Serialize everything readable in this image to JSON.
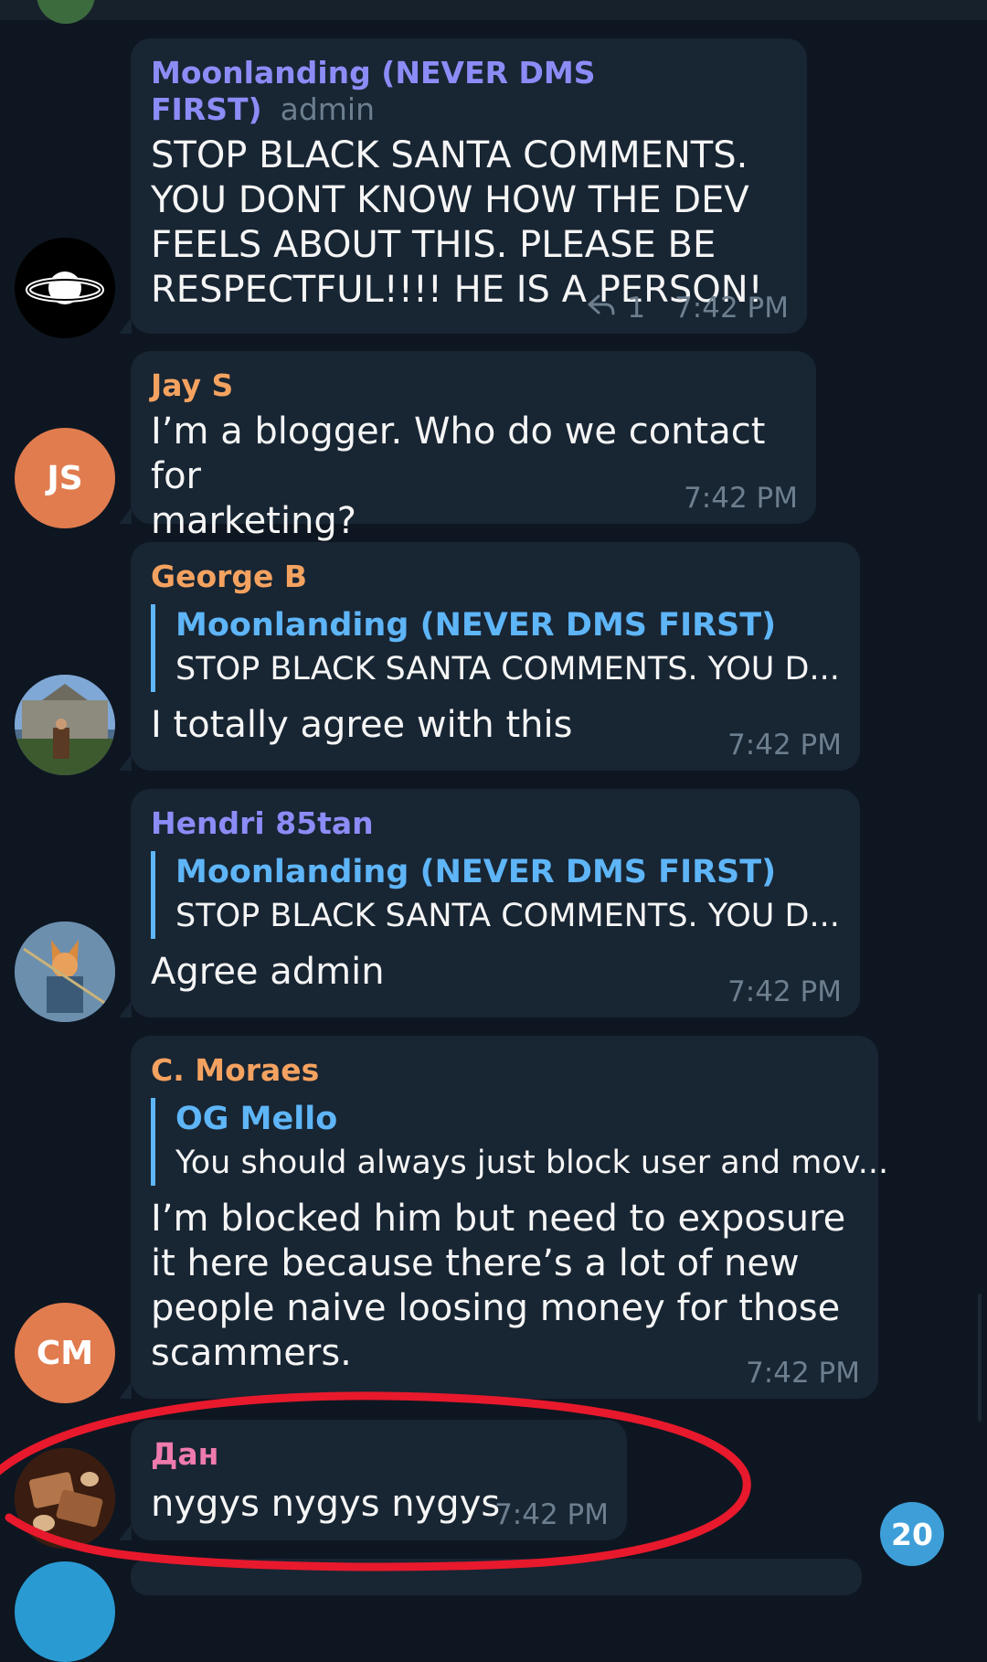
{
  "colors": {
    "background": "#0e1621",
    "bubble": "#182533",
    "meta": "#6d7f8f",
    "reply_accent": "#5eb5f7",
    "annotation": "#e8192c",
    "unread_badge": "#3e9fd8"
  },
  "messages": [
    {
      "sender": "Moonlanding (NEVER DMS FIRST)",
      "sender_color": "#8c8cf7",
      "role": "admin",
      "avatar": "saturn-logo",
      "text": "STOP BLACK SANTA COMMENTS.\nYOU DONT KNOW HOW THE DEV\nFEELS ABOUT THIS. PLEASE BE\nRESPECTFUL!!!! HE IS A PERSON!",
      "replies_count": "1",
      "time": "7:42 PM"
    },
    {
      "sender": "Jay S",
      "sender_color": "#f4a260",
      "avatar_initials": "JS",
      "text": "I’m a blogger. Who do we contact for\nmarketing?",
      "time": "7:42 PM"
    },
    {
      "sender": "George B",
      "sender_color": "#f4a260",
      "avatar": "photo-building",
      "reply_to": {
        "name": "Moonlanding (NEVER DMS FIRST)",
        "text": "STOP BLACK SANTA COMMENTS. YOU D..."
      },
      "text": "I totally agree with this",
      "time": "7:42 PM"
    },
    {
      "sender": "Hendri 85tan",
      "sender_color": "#8c8cf7",
      "avatar": "photo-fox-archer",
      "reply_to": {
        "name": "Moonlanding (NEVER DMS FIRST)",
        "text": "STOP BLACK SANTA COMMENTS. YOU D..."
      },
      "text": "Agree admin",
      "time": "7:42 PM"
    },
    {
      "sender": "C. Moraes",
      "sender_color": "#f4a260",
      "avatar_initials": "CM",
      "reply_to": {
        "name": "OG Mello",
        "text": "You should always just block user and mov..."
      },
      "text": "I’m blocked him but need to exposure\nit here because there’s a lot of new\npeople naive loosing money for those\nscammers.",
      "time": "7:42 PM"
    },
    {
      "sender": "Дан",
      "sender_color": "#ee7aae",
      "avatar": "photo-chocolate",
      "text": "nygys nygys nygys",
      "time": "7:42 PM"
    }
  ],
  "unread_count": "20"
}
